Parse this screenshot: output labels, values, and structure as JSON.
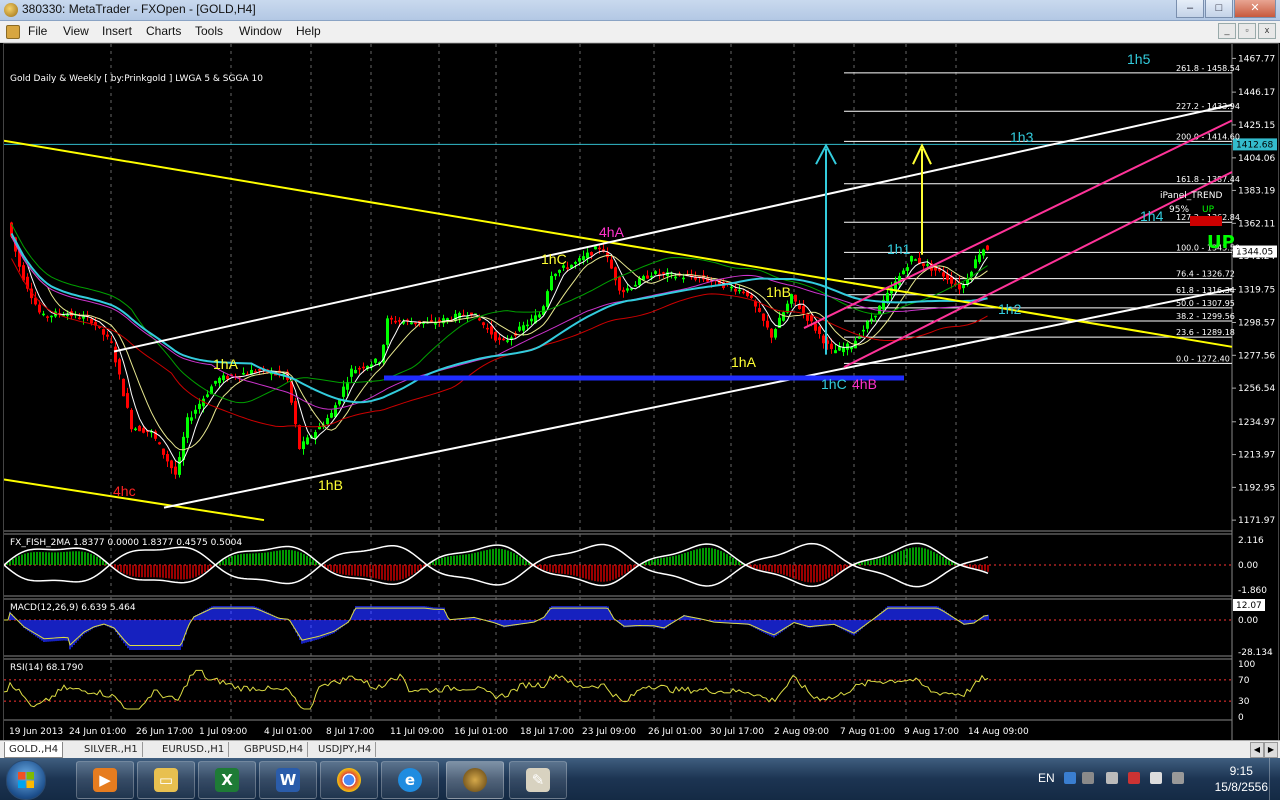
{
  "window": {
    "title": "380330: MetaTrader - FXOpen - [GOLD,H4]",
    "min_label": "–",
    "max_label": "□",
    "close_label": "✕"
  },
  "menu": {
    "items": [
      "File",
      "View",
      "Insert",
      "Charts",
      "Tools",
      "Window",
      "Help"
    ]
  },
  "chart": {
    "title": "Gold Daily & Weekly [ by:Prinkgold ] LWGA 5  &  SGGA 10",
    "price_axis": [
      "1467.77",
      "1446.17",
      "1425.15",
      "1404.06",
      "1383.19",
      "1362.11",
      "1341.24",
      "1319.75",
      "1298.57",
      "1277.56",
      "1256.54",
      "1234.97",
      "1213.97",
      "1192.95",
      "1171.97"
    ],
    "current_price": "1344.05",
    "highlight_price": "1412.68",
    "time_axis": [
      "19 Jun 2013",
      "24 Jun 01:00",
      "26 Jun 17:00",
      "1 Jul 09:00",
      "4 Jul 01:00",
      "8 Jul 17:00",
      "11 Jul 09:00",
      "16 Jul 01:00",
      "18 Jul 17:00",
      "23 Jul 09:00",
      "26 Jul 01:00",
      "30 Jul 17:00",
      "2 Aug 09:00",
      "7 Aug 01:00",
      "9 Aug 17:00",
      "14 Aug 09:00"
    ],
    "fib_levels": [
      "261.8 - 1458.54",
      "227.2 - 1433.94",
      "200.0 - 1414.60",
      "161.8 - 1387.44",
      "127.2 - 1362.84",
      "100.0 - 1343.50",
      "76.4 - 1326.72",
      "61.8 - 1316.34",
      "50.0 - 1307.95",
      "38.2 - 1299.56",
      "23.6 - 1289.18",
      "0.0 - 1272.40"
    ],
    "wave_labels": [
      "1h5",
      "1h3",
      "1h4",
      "1h1",
      "1h2",
      "4hA",
      "1hC",
      "1hB",
      "1hA",
      "1hA",
      "1hC",
      "4hB",
      "1hB",
      "4hc"
    ],
    "panel": {
      "title": "iPanel_TREND",
      "pct": "95%",
      "dir": "UP",
      "big": "UP"
    }
  },
  "indicators": {
    "fish": {
      "label": "FX_FISH_2MA 1.8377 0.0000 1.8377 0.4575 0.5004",
      "axis": [
        "2.116",
        "0.00",
        "-1.860"
      ]
    },
    "macd": {
      "label": "MACD(12,26,9) 6.639 5.464",
      "axis": [
        "12.07",
        "0.00",
        "-28.134"
      ]
    },
    "rsi": {
      "label": "RSI(14) 68.1790",
      "axis": [
        "100",
        "70",
        "30",
        "0"
      ]
    }
  },
  "tabs": [
    "GOLD.,H4",
    "SILVER.,H1",
    "EURUSD.,H1",
    "GBPUSD,H4",
    "USDJPY,H4"
  ],
  "taskbar": {
    "lang": "EN",
    "time": "9:15",
    "date": "15/8/2556"
  },
  "colors": {
    "bull": "#00ff00",
    "bear": "#ff0000",
    "fib": "#ffffff",
    "trend_yellow": "#ffff00",
    "trend_magenta": "#ff3399",
    "cyan_ma": "#33ccdd"
  }
}
